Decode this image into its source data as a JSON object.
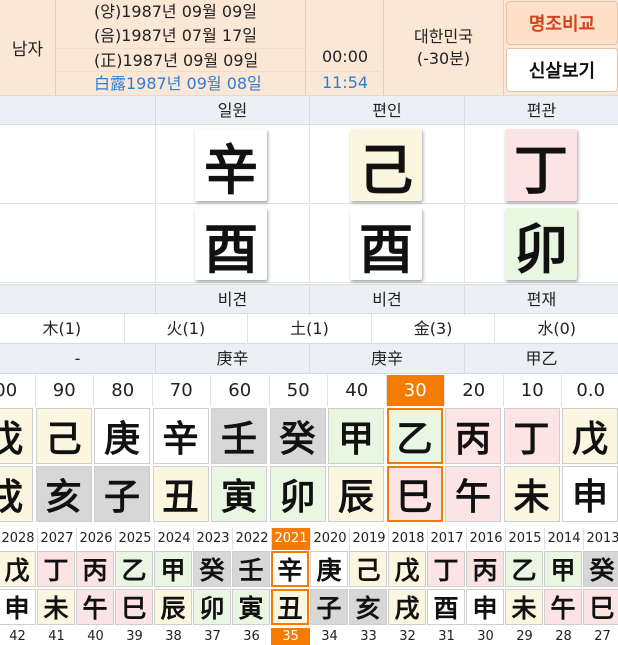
{
  "header": {
    "gender": "남자",
    "dates": [
      "(양)1987년 09월 09일",
      "(음)1987년 07월 17일",
      "(正)1987년 09월 09일",
      "白露1987년 09월 08일"
    ],
    "times": [
      "00:00",
      "11:54"
    ],
    "place": [
      "대한민국",
      "(-30분)"
    ],
    "buttons": [
      "명조비교",
      "신살보기"
    ]
  },
  "pillars": {
    "top_labels": [
      "",
      "일원",
      "편인",
      "편관"
    ],
    "stems": [
      "",
      "辛",
      "己",
      "丁"
    ],
    "branches": [
      "",
      "酉",
      "酉",
      "卯"
    ],
    "bottom_labels": [
      "",
      "비견",
      "비견",
      "편재"
    ]
  },
  "five_elements": [
    "木(1)",
    "火(1)",
    "土(1)",
    "金(3)",
    "水(0)"
  ],
  "hidden_stems": [
    "-",
    "庚辛",
    "庚辛",
    "甲乙"
  ],
  "daewoon": {
    "ages": [
      "00",
      "90",
      "80",
      "70",
      "60",
      "50",
      "40",
      "30",
      "20",
      "10",
      "0.0"
    ],
    "stems": [
      "戊",
      "己",
      "庚",
      "辛",
      "壬",
      "癸",
      "甲",
      "乙",
      "丙",
      "丁",
      "戊"
    ],
    "branches": [
      "戌",
      "亥",
      "子",
      "丑",
      "寅",
      "卯",
      "辰",
      "巳",
      "午",
      "未",
      "申"
    ],
    "selected_age": "30"
  },
  "seun": {
    "years": [
      "2028",
      "2027",
      "2026",
      "2025",
      "2024",
      "2023",
      "2022",
      "2021",
      "2020",
      "2019",
      "2018",
      "2017",
      "2016",
      "2015",
      "2014",
      "2013"
    ],
    "stems": [
      "戊",
      "丁",
      "丙",
      "乙",
      "甲",
      "癸",
      "壬",
      "辛",
      "庚",
      "己",
      "戊",
      "丁",
      "丙",
      "乙",
      "甲",
      "癸"
    ],
    "branches": [
      "申",
      "未",
      "午",
      "巳",
      "辰",
      "卯",
      "寅",
      "丑",
      "子",
      "亥",
      "戌",
      "酉",
      "申",
      "未",
      "午",
      "巳"
    ],
    "ages": [
      "42",
      "41",
      "40",
      "39",
      "38",
      "37",
      "36",
      "35",
      "34",
      "33",
      "32",
      "31",
      "30",
      "29",
      "28",
      "27"
    ],
    "selected_year": "2021"
  },
  "colors": {
    "wood": "#e8f6e2",
    "fire": "#fde4e4",
    "earth": "#fbf6df",
    "metal": "#ffffff",
    "water": "#d7d7d7",
    "accent": "#f57c00",
    "header_bg": "#fbe7d6",
    "blue_text": "#2e7ed6",
    "compare_button_text": "#d4421e"
  }
}
